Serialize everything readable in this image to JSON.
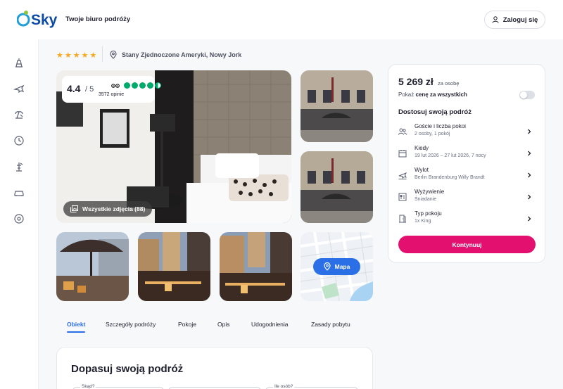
{
  "header": {
    "logo_text": "eSky",
    "tagline": "Twoje biuro podróży",
    "login_label": "Zaloguj się"
  },
  "sidebar": {
    "icons": [
      "hotel-icon",
      "flight-icon",
      "vacation-icon",
      "last-minute-icon",
      "holidays-icon",
      "car-icon",
      "other-icon"
    ]
  },
  "hotel": {
    "stars": "★★★★★",
    "location": "Stany Zjednoczone Ameryki, Nowy Jork"
  },
  "rating": {
    "score": "4.4",
    "out_of": "/ 5",
    "reviews": "3572 opinie"
  },
  "gallery": {
    "all_photos_label": "Wszystkie zdjęcia (88)",
    "map_label": "Mapa"
  },
  "tabs": [
    "Obiekt",
    "Szczegóły podróży",
    "Pokoje",
    "Opis",
    "Udogodnienia",
    "Zasady pobytu"
  ],
  "trip": {
    "title": "Dopasuj swoją podróż",
    "field_from": "Skąd?",
    "field_people": "Ile osób?"
  },
  "booking": {
    "price": "5 269 zł",
    "price_suffix": "za osobę",
    "show_total_prefix": "Pokaż ",
    "show_total_bold": "cenę za wszystkich",
    "section_title": "Dostosuj swoją podróż",
    "options": [
      {
        "title": "Goście i liczba pokoi",
        "subtitle": "2 osoby, 1 pokój",
        "icon": "guests-icon"
      },
      {
        "title": "Kiedy",
        "subtitle": "19 lut 2026 – 27 lut 2026, 7 nocy",
        "icon": "calendar-icon"
      },
      {
        "title": "Wylot",
        "subtitle": "Berlin Brandenburg Willy Brandt",
        "icon": "departure-icon"
      },
      {
        "title": "Wyżywienie",
        "subtitle": "Śniadanie",
        "icon": "food-icon"
      },
      {
        "title": "Typ pokoju",
        "subtitle": "1x King",
        "icon": "room-icon"
      }
    ],
    "continue_label": "Kontynuuj"
  },
  "colors": {
    "brand_blue": "#2b6fe6",
    "cta_pink": "#e3106f",
    "rating_green": "#00aa6c",
    "star_gold": "#f5a623"
  }
}
